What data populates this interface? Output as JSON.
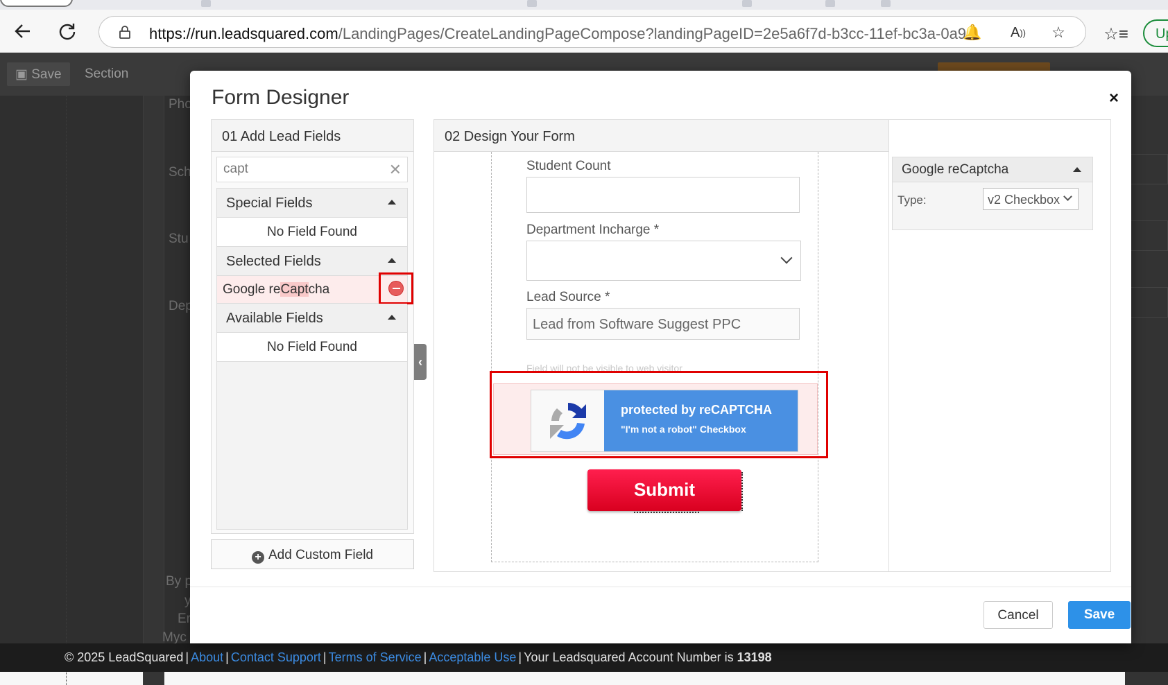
{
  "browser": {
    "url_host": "https://run.leadsquared.com",
    "url_path": "/LandingPages/CreateLandingPageCompose?landingPageID=2e5a6f7d-b3cc-11ef-bc3a-0a98...",
    "update_label": "Up"
  },
  "page": {
    "save_label": "Save",
    "section_label": "Section",
    "bg_labels": [
      "Pho",
      "Sch",
      "Stu",
      "Dep"
    ],
    "bg_bottom": [
      "By p",
      "y",
      "Er",
      "Myc"
    ]
  },
  "modal": {
    "title": "Form Designer",
    "close_label": "×",
    "left_panel": {
      "title": "01 Add Lead Fields",
      "search_value": "capt",
      "sections": {
        "special": {
          "title": "Special Fields",
          "empty": "No Field Found"
        },
        "selected": {
          "title": "Selected Fields",
          "item_prefix": "Google re",
          "item_match": "Capt",
          "item_suffix": "cha"
        },
        "available": {
          "title": "Available Fields",
          "empty": "No Field Found"
        }
      },
      "add_custom_label": "Add Custom Field"
    },
    "right_panel": {
      "title": "02 Design Your Form",
      "fields": [
        {
          "label": "Student Count"
        },
        {
          "label": "Department Incharge *"
        },
        {
          "label": "Lead Source *",
          "value": "Lead from Software Suggest PPC",
          "hint": "Field will not be visible to web visitor"
        }
      ],
      "recaptcha": {
        "line1": "protected by reCAPTCHA",
        "line2": "\"I'm not a robot\" Checkbox"
      },
      "submit_label": "Submit",
      "properties": {
        "title": "Google reCaptcha",
        "type_label": "Type:",
        "type_value": "v2 Checkbox"
      }
    },
    "footer": {
      "cancel_label": "Cancel",
      "save_label": "Save"
    }
  },
  "footer": {
    "copyright": "© 2025 LeadSquared",
    "links": [
      "About",
      "Contact Support",
      "Terms of Service",
      "Acceptable Use"
    ],
    "account_text": "Your Leadsquared Account Number is",
    "account_number": "13198"
  },
  "colors": {
    "highlight_red": "#e00000",
    "submit_red": "#e8002e",
    "save_blue": "#2d91e8",
    "recaptcha_blue": "#4a90e2",
    "link_blue": "#3d8ee6"
  }
}
